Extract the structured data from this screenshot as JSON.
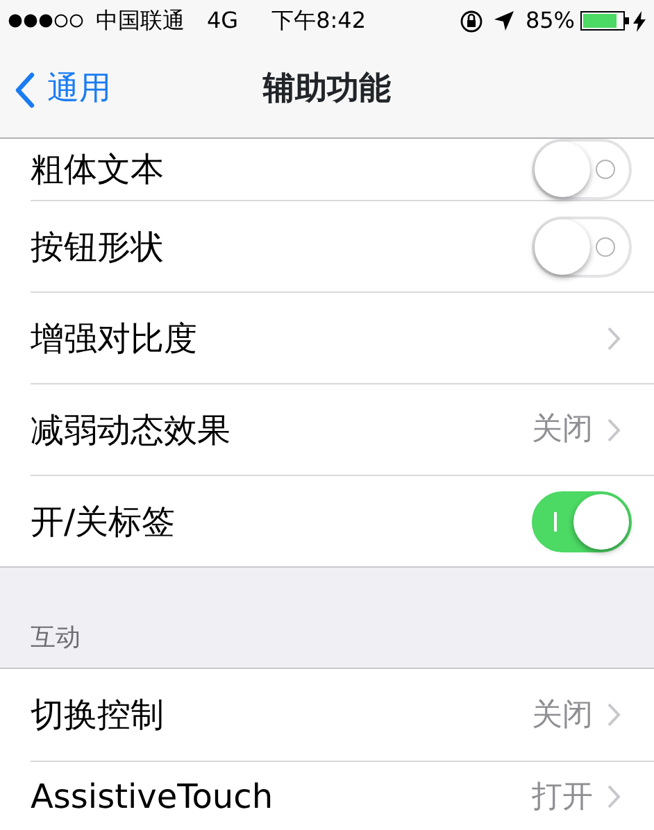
{
  "status_bar": {
    "carrier": "中国联通",
    "network": "4G",
    "time": "下午8:42",
    "battery": "85%"
  },
  "nav": {
    "back": "通用",
    "title": "辅助功能"
  },
  "groups": [
    {
      "rows": [
        {
          "label": "粗体文本",
          "kind": "toggle",
          "on": false
        },
        {
          "label": "按钮形状",
          "kind": "toggle",
          "on": false
        },
        {
          "label": "增强对比度",
          "kind": "link"
        },
        {
          "label": "减弱动态效果",
          "kind": "link",
          "value": "关闭"
        },
        {
          "label": "开/关标签",
          "kind": "toggle",
          "on": true
        }
      ]
    },
    {
      "header": "互动",
      "rows": [
        {
          "label": "切换控制",
          "kind": "link",
          "value": "关闭"
        },
        {
          "label": "AssistiveTouch",
          "kind": "link",
          "value": "打开"
        }
      ]
    }
  ]
}
